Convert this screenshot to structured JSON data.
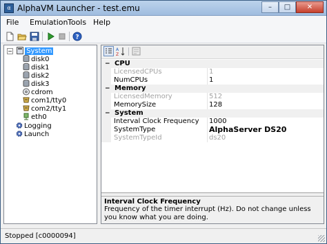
{
  "window": {
    "title": "AlphaVM Launcher - test.emu",
    "icon": "app-icon",
    "controls": {
      "minimize": "–",
      "maximize": "□",
      "close": "✕"
    }
  },
  "menu": [
    "File",
    "Emulation",
    "Tools",
    "Help"
  ],
  "toolbar": {
    "icons": [
      "new-file-icon",
      "open-folder-icon",
      "save-icon",
      "play-icon",
      "stop-icon",
      "help-icon"
    ]
  },
  "tree": {
    "root": {
      "label": "System",
      "expander": "−"
    },
    "children": [
      "disk0",
      "disk1",
      "disk2",
      "disk3",
      "cdrom",
      "com1/tty0",
      "com2/tty1",
      "eth0"
    ],
    "bottom": [
      "Logging",
      "Launch"
    ]
  },
  "properties": {
    "categories": [
      {
        "name": "CPU",
        "toggle": "−",
        "rows": [
          {
            "name": "LicensedCPUs",
            "value": "1",
            "disabled": true
          },
          {
            "name": "NumCPUs",
            "value": "1",
            "disabled": false
          }
        ]
      },
      {
        "name": "Memory",
        "toggle": "−",
        "rows": [
          {
            "name": "LicensedMemory",
            "value": "512",
            "disabled": true
          },
          {
            "name": "MemorySize",
            "value": "128",
            "disabled": false
          }
        ]
      },
      {
        "name": "System",
        "toggle": "−",
        "rows": [
          {
            "name": "Interval Clock Frequency",
            "value": "1000",
            "disabled": false
          },
          {
            "name": "SystemType",
            "value": "AlphaServer DS20",
            "disabled": false,
            "bold": true
          },
          {
            "name": "SystemTypeId",
            "value": "ds20",
            "disabled": true
          }
        ]
      }
    ]
  },
  "help": {
    "title": "Interval Clock Frequency",
    "description": "Frequency of the timer interrupt (Hz). Do not change unless you know what you are doing."
  },
  "status": {
    "text": "Stopped [c0000094]"
  },
  "colors": {
    "selection": "#3399ff",
    "disabled_text": "#a3a3a3",
    "title_bar": "#bcd3ec"
  }
}
